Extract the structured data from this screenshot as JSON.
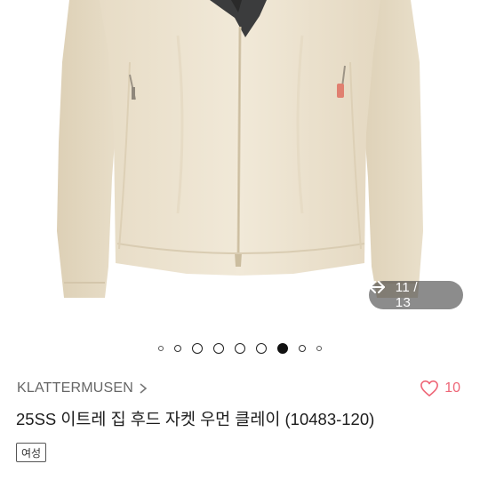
{
  "gallery": {
    "image_desc": "jacket-photo",
    "counter": {
      "text": "11 / 13",
      "prev_icon": "arrow-left-icon",
      "next_icon": "arrow-right-icon"
    },
    "dots_total": 9,
    "dots_active_index": 6
  },
  "product": {
    "brand": "KLATTERMUSEN",
    "title": "25SS  이트레 집 후드 자켓 우먼 클레이 (10483-120)",
    "like_count": "10",
    "tag": "여성"
  },
  "colors": {
    "jacket": "#efe6d4",
    "like_red": "#ee6677"
  }
}
